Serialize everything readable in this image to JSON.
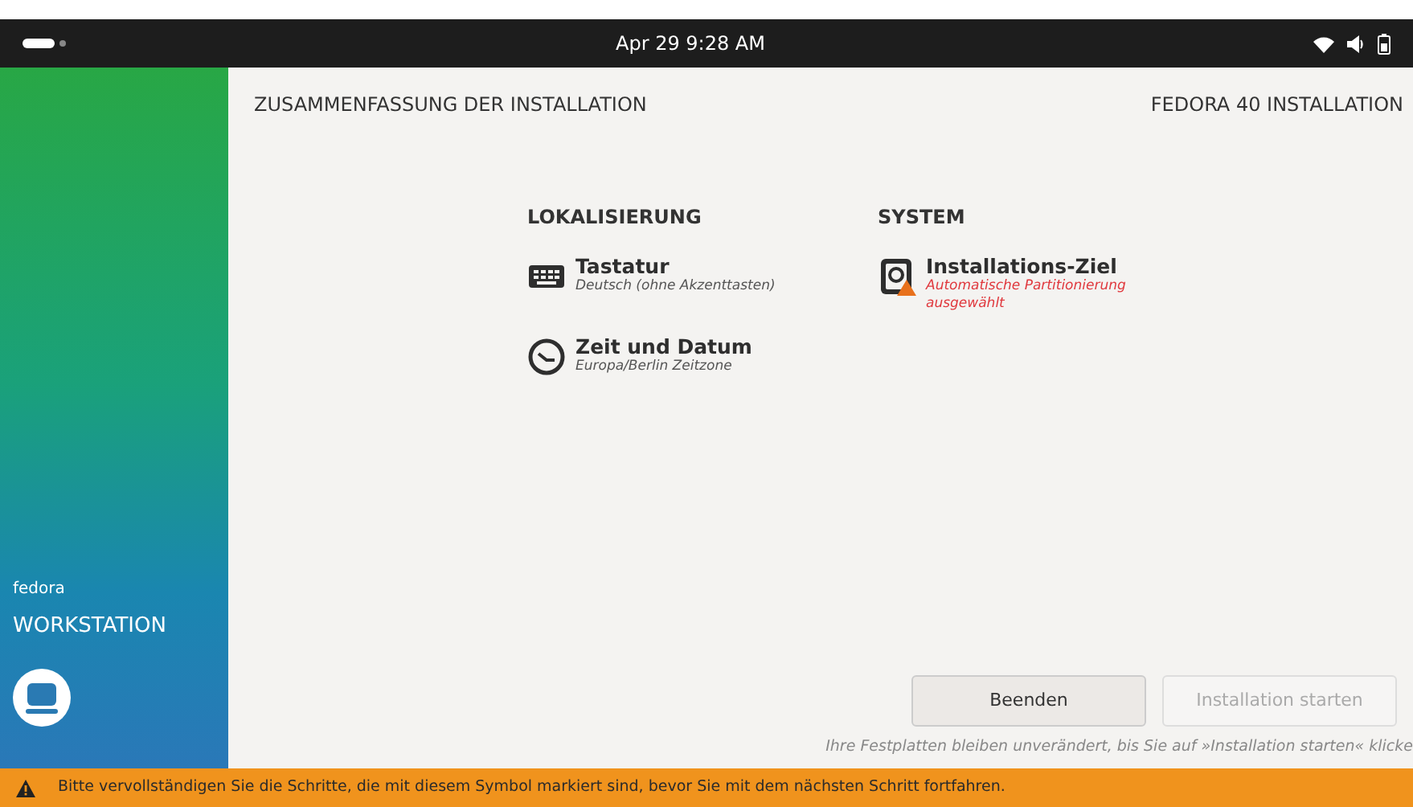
{
  "top_bar": {
    "clock": "Apr 29   9:28 AM"
  },
  "sidebar": {
    "brand_small": "fedora",
    "brand_large": "WORKSTATION"
  },
  "header": {
    "title": "ZUSAMMENFASSUNG DER INSTALLATION",
    "product": "FEDORA 40 INSTALLATION"
  },
  "sections": [
    {
      "title": "LOKALISIERUNG",
      "spokes": [
        {
          "kind": "keyboard",
          "title": "Tastatur",
          "status": "Deutsch (ohne Akzenttasten)",
          "warning": false
        },
        {
          "kind": "clock",
          "title": "Zeit und Datum",
          "status": "Europa/Berlin Zeitzone",
          "warning": false
        }
      ]
    },
    {
      "title": "SYSTEM",
      "spokes": [
        {
          "kind": "disk",
          "title": "Installations-Ziel",
          "status": "Automatische Partitionierung ausgewählt",
          "warning": true
        }
      ]
    }
  ],
  "buttons": [
    {
      "label": "Beenden",
      "disabled": false
    },
    {
      "label": "Installation starten",
      "disabled": true
    }
  ],
  "note": "Ihre Festplatten bleiben unverändert, bis Sie auf »Installation starten« klicke",
  "warning_bar": "Bitte vervollständigen Sie die Schritte, die mit diesem Symbol markiert sind, bevor Sie mit dem nächsten Schritt fortfahren."
}
